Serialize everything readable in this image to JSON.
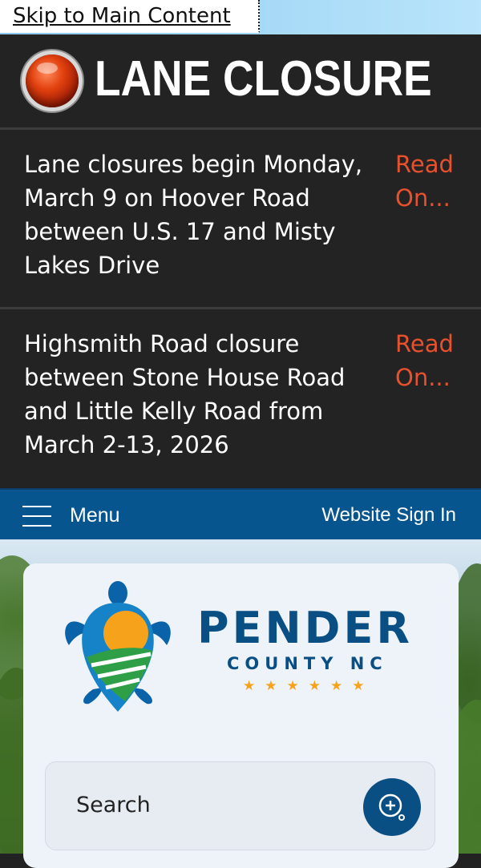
{
  "skip_link": {
    "label": "Skip to Main Content"
  },
  "alert": {
    "title": "LANE CLOSURE",
    "items": [
      {
        "text": "Lane closures begin Monday, March 9 on Hoover Road between U.S. 17 and Misty Lakes Drive",
        "link_label": "Read On..."
      },
      {
        "text": "Highsmith Road closure between Stone House Road and Little Kelly Road from March 2-13, 2026",
        "link_label": "Read On..."
      }
    ]
  },
  "nav": {
    "menu_label": "Menu",
    "sign_in_label": "Website Sign In"
  },
  "logo": {
    "name": "PENDER",
    "subtitle": "COUNTY NC",
    "stars": "★★★★★★"
  },
  "search": {
    "placeholder": "Search",
    "button_icon": "search-plus-icon"
  },
  "colors": {
    "alert_link": "#e8512d",
    "nav_bar": "#07558f",
    "brand_blue": "#0a4f84",
    "star": "#f6a31b"
  }
}
